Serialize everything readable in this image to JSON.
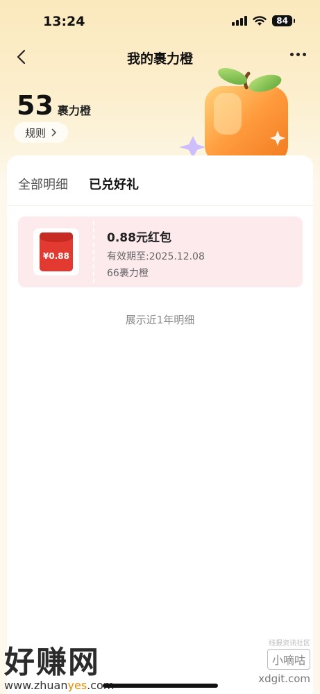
{
  "status_bar": {
    "time": "13:24",
    "battery": "84"
  },
  "nav": {
    "title": "我的裹力橙"
  },
  "points": {
    "value": "53",
    "unit": "裹力橙",
    "rules_label": "规则"
  },
  "tabs": [
    {
      "label": "全部明细",
      "active": false
    },
    {
      "label": "已兑好礼",
      "active": true
    }
  ],
  "gift": {
    "thumb_label": "¥0.88",
    "name": "0.88元红包",
    "expiry": "有效期至:2025.12.08",
    "cost": "66裹力橙"
  },
  "footnote": "展示近1年明细",
  "watermark": {
    "left_big": "好赚网",
    "left_url_a": "www.zhuan",
    "left_url_b": "yes",
    "left_url_c": ".com",
    "right_small": "线报资讯社区",
    "right_box": "小嘀咕",
    "right_site": "xdgit.com"
  },
  "colors": {
    "accent": "#fbd98a",
    "envelope_red": "#e23a30",
    "card_bg": "#fdeaec"
  }
}
